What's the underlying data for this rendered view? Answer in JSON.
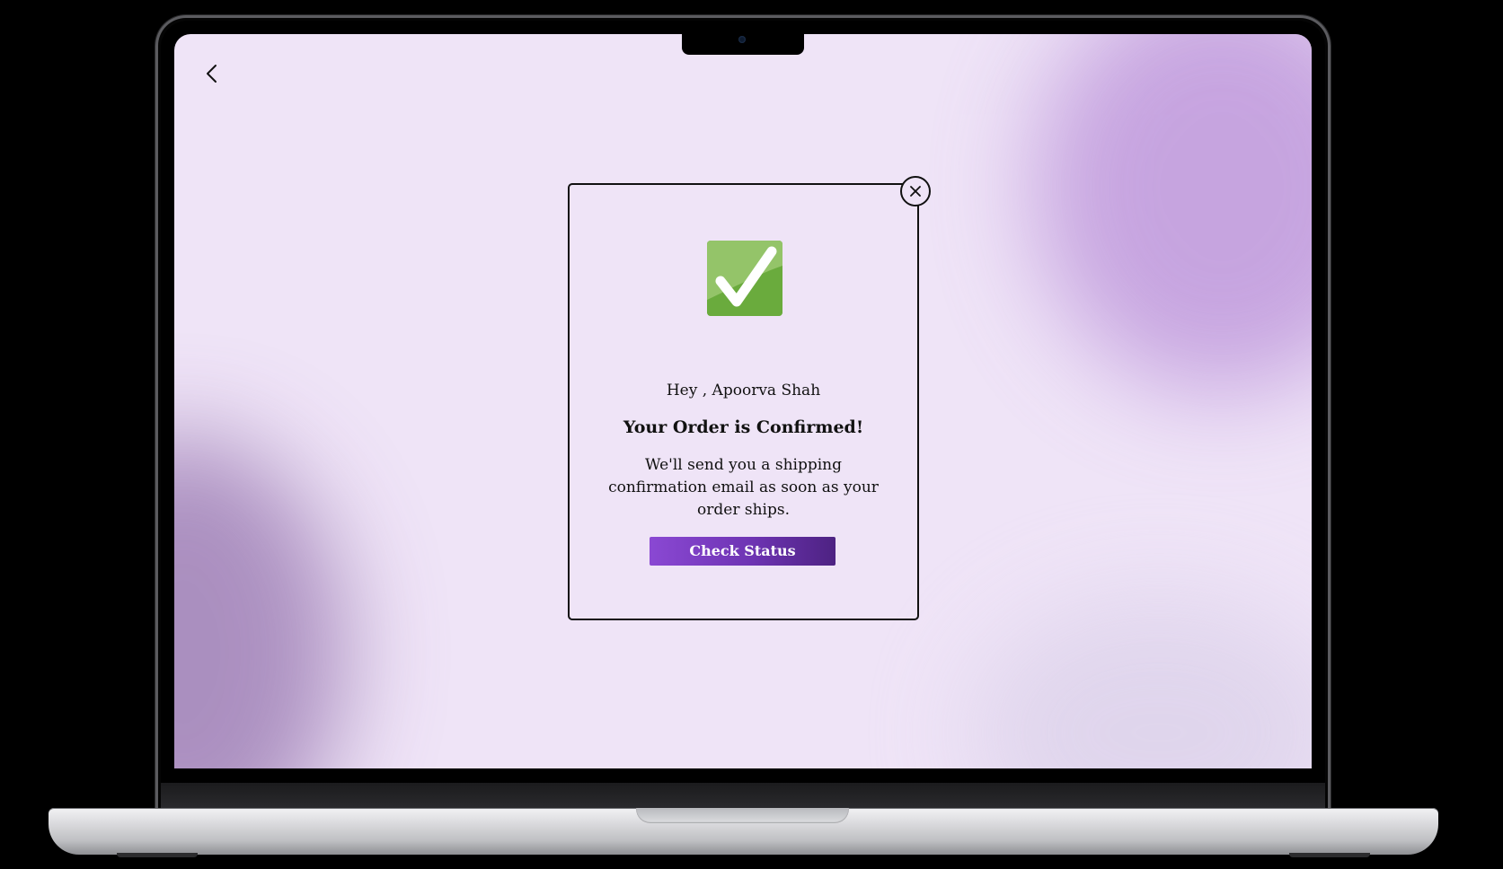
{
  "screen": {
    "background_color": "#efe4f7",
    "back_icon": "chevron-left-icon"
  },
  "modal": {
    "close_icon": "close-icon",
    "status_icon": "check-mark-icon",
    "status_icon_color": "#6aab3d",
    "greeting": "Hey , Apoorva Shah",
    "title": "Your Order is Confirmed!",
    "message": "We'll send you a shipping confirmation email as soon as your order ships.",
    "button_label": "Check Status",
    "button_color": "#7b3fc4"
  }
}
